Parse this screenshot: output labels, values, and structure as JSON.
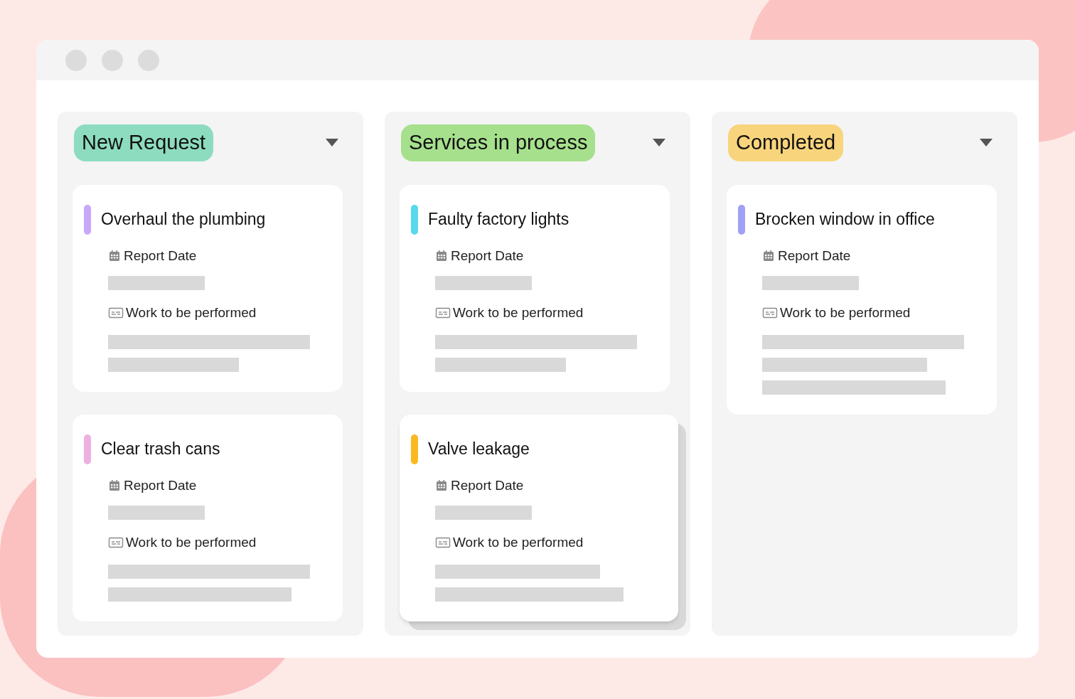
{
  "columns": [
    {
      "title": "New Request",
      "color": "#8ddcc0",
      "cards": [
        {
          "title": "Overhaul the plumbing",
          "color": "#c8a8f8",
          "dragging": false,
          "date_label": "Report Date",
          "work_label": "Work to be performed"
        },
        {
          "title": "Clear trash cans",
          "color": "#eeb0e0",
          "dragging": false,
          "date_label": "Report Date",
          "work_label": "Work to be performed"
        }
      ]
    },
    {
      "title": "Services in process",
      "color": "#a6e08c",
      "cards": [
        {
          "title": "Faulty factory lights",
          "color": "#58d8ec",
          "dragging": false,
          "date_label": "Report Date",
          "work_label": "Work to be performed"
        },
        {
          "title": "Valve leakage",
          "color": "#fbb820",
          "dragging": true,
          "date_label": "Report Date",
          "work_label": "Work to be performed"
        }
      ]
    },
    {
      "title": "Completed",
      "color": "#f8d47c",
      "cards": [
        {
          "title": "Brocken window in office",
          "color": "#a0a0f4",
          "dragging": false,
          "date_label": "Report Date",
          "work_label": "Work to be performed"
        }
      ]
    }
  ]
}
